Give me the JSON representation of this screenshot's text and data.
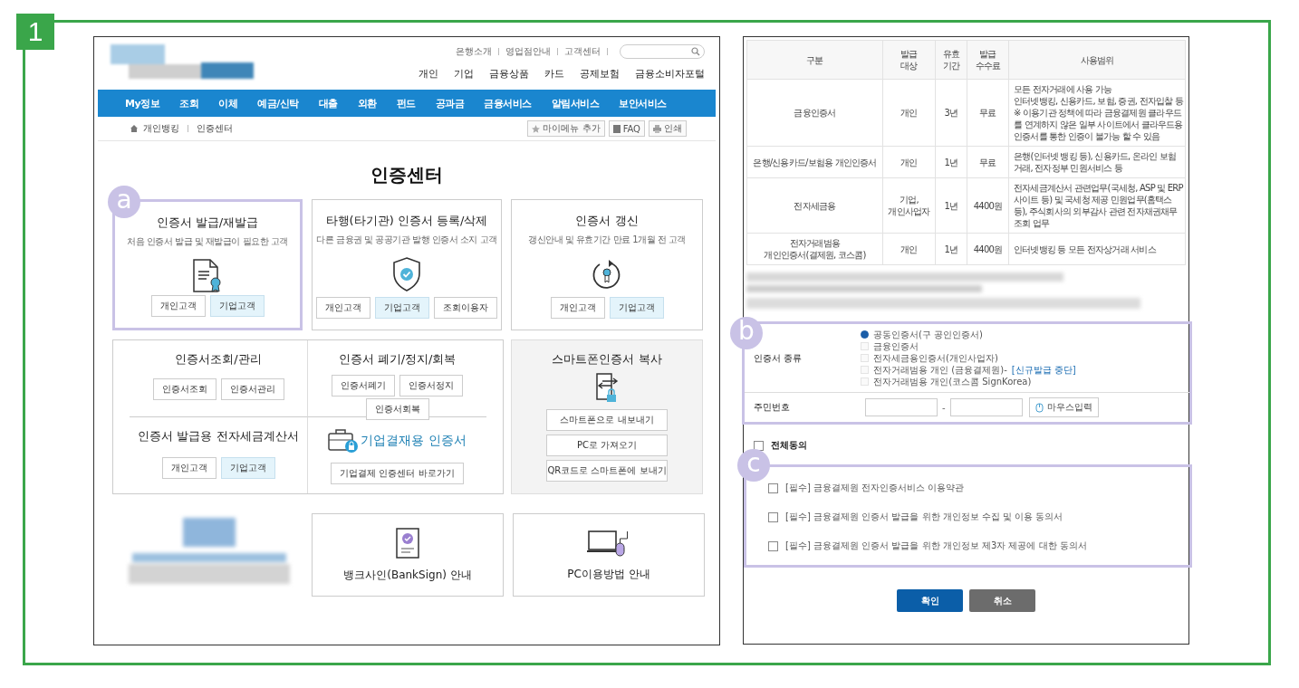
{
  "badge": "1",
  "bank_page": {
    "util_links": [
      "은행소개",
      "영업점안내",
      "고객센터"
    ],
    "main_nav": [
      "개인",
      "기업",
      "금융상품",
      "카드",
      "공제보험",
      "금융소비자포털"
    ],
    "menu": [
      "My정보",
      "조회",
      "이체",
      "예금/신탁",
      "대출",
      "외환",
      "펀드",
      "공과금",
      "금융서비스",
      "알림서비스",
      "보안서비스"
    ],
    "breadcrumb": [
      "개인뱅킹",
      "인증센터"
    ],
    "tools": [
      "마이메뉴 추가",
      "FAQ",
      "인쇄"
    ],
    "title": "인증센터",
    "cards": [
      {
        "title": "인증서 발급/재발급",
        "desc": "처음 인증서 발급 및 재발급이 필요한 고객",
        "marker": "a",
        "buttons": [
          {
            "label": "개인고객",
            "tinted": false
          },
          {
            "label": "기업고객",
            "tinted": true
          }
        ]
      },
      {
        "title": "타행(타기관) 인증서 등록/삭제",
        "desc": "다른 금융권 및 공공기관 발행 인증서 소지 고객",
        "buttons": [
          {
            "label": "개인고객",
            "tinted": false
          },
          {
            "label": "기업고객",
            "tinted": true
          },
          {
            "label": "조회이용자",
            "tinted": false
          }
        ]
      },
      {
        "title": "인증서 갱신",
        "desc": "갱신안내 및 유효기간 만료 1개월 전 고객",
        "buttons": [
          {
            "label": "개인고객",
            "tinted": false
          },
          {
            "label": "기업고객",
            "tinted": true
          }
        ]
      }
    ],
    "service_box": [
      {
        "kind": "plain",
        "title": "인증서조회/관리",
        "buttons": [
          {
            "label": "인증서조회",
            "tinted": false
          },
          {
            "label": "인증서관리",
            "tinted": false
          }
        ]
      },
      {
        "kind": "plain",
        "title": "인증서 폐기/정지/회복",
        "buttons": [
          {
            "label": "인증서폐기",
            "tinted": false
          },
          {
            "label": "인증서정지",
            "tinted": false
          },
          {
            "label": "인증서회복",
            "tinted": false
          }
        ]
      },
      {
        "kind": "plain",
        "title": "인증서 발급용 전자세금계산서",
        "buttons": [
          {
            "label": "개인고객",
            "tinted": false
          },
          {
            "label": "기업고객",
            "tinted": true
          }
        ]
      },
      {
        "kind": "feature",
        "title": "기업결재용 인증서",
        "buttons": [
          {
            "label": "기업결제 인증센터 바로가기",
            "tinted": false
          }
        ]
      }
    ],
    "smart_copy": {
      "title": "스마트폰인증서 복사",
      "buttons": [
        "스마트폰으로 내보내기",
        "PC로 가져오기",
        "QR코드로 스마트폰에 보내기"
      ]
    },
    "guides": [
      "뱅크사인(BankSign) 안내",
      "PC이용방법 안내"
    ]
  },
  "cert_form": {
    "table": {
      "columns": [
        "구분",
        "발급\n대상",
        "유효\n기간",
        "발급\n수수료",
        "사용범위"
      ],
      "rows": [
        [
          "금융인증서",
          "개인",
          "3년",
          "무료",
          "모든 전자거래에 사용 가능\n인터넷뱅킹, 신용카드, 보험, 증권, 전자입찰 등\n※ 이용기관 정책에 따라 금융결제원 클라우드를 연계하지 않은 일부 사이트에서 클라우드용 인증서를 통한 인증이 불가능 할 수 있음"
        ],
        [
          "은행/신용카드/보험용 개인인증서",
          "개인",
          "1년",
          "무료",
          "은행(인터넷 뱅킹 등), 신용카드, 온라인 보험거래, 전자정부 민원서비스 등"
        ],
        [
          "전자세금용",
          "기업,\n개인사업자",
          "1년",
          "4400원",
          "전자세금계산서 관련업무(국세청, ASP 및 ERP사이트 등) 및 국세청 제공 민원업무(홈택스 등), 주식회사의 외부감사 관련 전자채권채무 조회 업무"
        ],
        [
          "전자거래범용\n개인인증서(결제원, 코스콤)",
          "개인",
          "1년",
          "4400원",
          "인터넷뱅킹 등 모든 전자상거래 서비스"
        ]
      ]
    },
    "fields": {
      "marker": "b",
      "type_label": "인증서 종류",
      "options": [
        {
          "label": "공동인증서(구 공인인증서)",
          "selected": true
        },
        {
          "label": "금융인증서",
          "selected": false
        },
        {
          "label": "전자세금용인증서(개인사업자)",
          "selected": false
        },
        {
          "label": "전자거래범용 개인 (금융결제원)-",
          "note": "[신규발급 중단]",
          "selected": false
        },
        {
          "label": "전자거래범용 개인(코스콤 SignKorea)",
          "selected": false
        }
      ],
      "id_label": "주민번호",
      "separator": "-",
      "mouse_button": "마우스입력"
    },
    "agree_all": {
      "label": "전체동의",
      "checked": false
    },
    "agreements": {
      "marker": "c",
      "items": [
        {
          "label": "[필수] 금융결제원 전자인증서비스 이용약관",
          "checked": false
        },
        {
          "label": "[필수] 금융결제원 인증서 발급을 위한 개인정보 수집 및 이용 동의서",
          "checked": false
        },
        {
          "label": "[필수] 금융결제원 인증서 발급을 위한 개인정보 제3자 제공에 대한 동의서",
          "checked": false
        }
      ]
    },
    "buttons": [
      {
        "label": "확인",
        "kind": "primary"
      },
      {
        "label": "취소",
        "kind": "secondary"
      }
    ]
  }
}
